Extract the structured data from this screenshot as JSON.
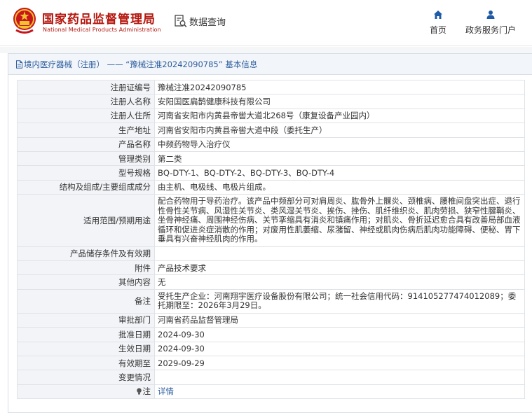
{
  "header": {
    "site_name_cn": "国家药品监督管理局",
    "site_name_en": "National Medical Products Administration",
    "data_query_label": "数据查询",
    "nav": [
      {
        "label": "首页",
        "icon": "home-icon"
      },
      {
        "label": "政务服务门户",
        "icon": "user-icon"
      }
    ]
  },
  "breadcrumb": {
    "text": "境内医疗器械（注册） —— “豫械注准20242090785” 基本信息"
  },
  "rows": [
    {
      "label": "注册证编号",
      "value": "豫械注准20242090785"
    },
    {
      "label": "注册人名称",
      "value": "安阳国医扁鹊健康科技有限公司"
    },
    {
      "label": "注册人住所",
      "value": "河南省安阳市内黄县帝喾大道北268号（康复设备产业园内）"
    },
    {
      "label": "生产地址",
      "value": "河南省安阳市内黄县帝喾大道中段（委托生产）"
    },
    {
      "label": "产品名称",
      "value": "中频药物导入治疗仪"
    },
    {
      "label": "管理类别",
      "value": "第二类"
    },
    {
      "label": "型号规格",
      "value": "BQ-DTY-1、BQ-DTY-2、BQ-DTY-3、BQ-DTY-4"
    },
    {
      "label": "结构及组成/主要组成成分",
      "value": "由主机、电极线、电极片组成。"
    },
    {
      "label": "适用范围/预期用途",
      "value": "配合药物用于导药治疗。该产品中频部分可对肩周炎、肱骨外上髁炎、颈椎病、腰椎间盘突出症、退行性骨性关节病、风湿性关节炎、类风湿关节炎、挨伤、挫伤、肌纤维织炎、肌肉劳损、狭窄性腱鞘炎、坐骨神经痛、周围神经伤病、关节挛缩具有消炎和镇痛作用；对肌炎、骨折延迟愈合具有改善局部血液循环和促进炎症消散的作用；对废用性肌萎缩、尿潴留、神经或肌肉伤病后肌肉功能障碍、便秘、胃下垂具有兴奋神经肌肉的作用。"
    },
    {
      "label": "产品储存条件及有效期",
      "value": ""
    },
    {
      "label": "附件",
      "value": "产品技术要求"
    },
    {
      "label": "其他内容",
      "value": "无"
    },
    {
      "label": "备注",
      "value": "受托生产企业：河南翔宇医疗设备股份有限公司；统一社会信用代码：914105277474012089；委托期限至：2026年3月29日。"
    },
    {
      "label": "审批部门",
      "value": "河南省药品监督管理局"
    },
    {
      "label": "批准日期",
      "value": "2024-09-30"
    },
    {
      "label": "生效日期",
      "value": "2024-09-30"
    },
    {
      "label": "有效期至",
      "value": "2029-09-29"
    },
    {
      "label": "变更情况",
      "value": ""
    },
    {
      "label": "注",
      "value": "详情"
    }
  ],
  "colors": {
    "brand_red": "#b4170f",
    "link_blue": "#2c5d9e",
    "label_bg": "#f2f4f7",
    "border": "#dfe3e8"
  }
}
